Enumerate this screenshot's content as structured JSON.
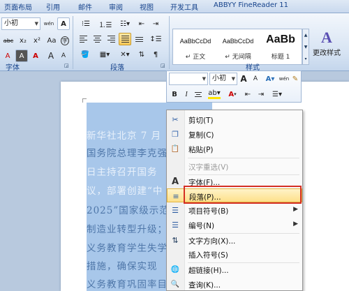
{
  "tabs": [
    "页面布局",
    "引用",
    "邮件",
    "审阅",
    "视图",
    "开发工具",
    "ABBYY FineReader 11"
  ],
  "ribbon": {
    "font_size": "小初",
    "phonetic_label": "wén",
    "char_border_label": "A",
    "clear_label": "abc",
    "x2_label": "x₂",
    "x2sup_label": "x²",
    "char_shade_label": "A",
    "bigger_label": "A",
    "smaller_label": "A",
    "aa_label": "Aa",
    "circle_label": "字",
    "groups": {
      "font": "字体",
      "paragraph": "段落",
      "styles": "样式"
    },
    "styles": [
      {
        "preview": "AaBbCcDd",
        "name": "↵ 正文"
      },
      {
        "preview": "AaBbCcDd",
        "name": "↵ 无间隔"
      },
      {
        "preview": "AaBb",
        "name": "标题 1"
      }
    ],
    "change_style": "更改样式",
    "change_style_icon_text": "A"
  },
  "mini_toolbar": {
    "font_size": "小初",
    "bold": "B",
    "italic": "I",
    "grow": "A",
    "shrink": "A",
    "font_color": "A",
    "format_painter": "wén"
  },
  "document": {
    "lines": [
      "新华社北京 7 月",
      "国务院总理李克强",
      "日主持召开国务",
      "议，部署创建“中",
      "2025”国家级示范",
      "制造业转型升级；",
      "义务教育学生失学",
      "措施，确保实现",
      "义务教育巩固率目"
    ]
  },
  "context_menu": {
    "items": [
      {
        "label": "剪切(T)",
        "icon": "scissors-icon",
        "glyph": "✂",
        "disabled": false
      },
      {
        "label": "复制(C)",
        "icon": "copy-icon",
        "glyph": "❐",
        "disabled": false
      },
      {
        "label": "粘贴(P)",
        "icon": "paste-icon",
        "glyph": "📋",
        "disabled": false
      },
      {
        "label": "汉字重选(V)",
        "icon": "",
        "glyph": "",
        "disabled": true
      },
      {
        "label": "字体(F)...",
        "icon": "font-icon",
        "glyph": "A",
        "disabled": false
      },
      {
        "label": "段落(P)...",
        "icon": "paragraph-icon",
        "glyph": "≡",
        "disabled": false
      },
      {
        "label": "项目符号(B)",
        "icon": "bullets-icon",
        "glyph": "☰",
        "disabled": false,
        "submenu": "▶"
      },
      {
        "label": "编号(N)",
        "icon": "numbering-icon",
        "glyph": "☰",
        "disabled": false,
        "submenu": "▶"
      },
      {
        "label": "文字方向(X)...",
        "icon": "text-direction-icon",
        "glyph": "⇅",
        "disabled": false
      },
      {
        "label": "插入符号(S)",
        "icon": "",
        "glyph": "",
        "disabled": false
      },
      {
        "label": "超链接(H)...",
        "icon": "hyperlink-icon",
        "glyph": "🌐",
        "disabled": false
      },
      {
        "label": "查询(K)...",
        "icon": "lookup-icon",
        "glyph": "🔍",
        "disabled": false
      }
    ]
  },
  "colors": {
    "highlight": "#d42f24",
    "selection": "#a8c7ea",
    "hover": "#fde08a"
  }
}
